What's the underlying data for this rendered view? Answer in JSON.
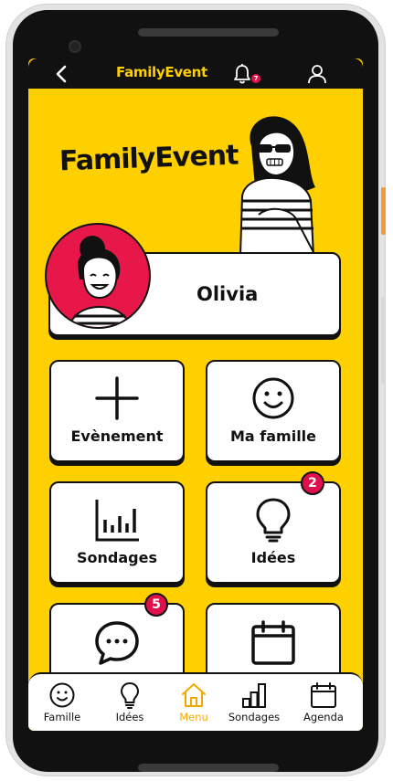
{
  "header": {
    "title": "FamilyEvent",
    "notification_count": "7"
  },
  "brand": {
    "name": "FamilyEvent"
  },
  "profile": {
    "name": "Olivia"
  },
  "tiles": [
    {
      "label": "Evènement",
      "icon": "plus-icon"
    },
    {
      "label": "Ma famille",
      "icon": "smiley-icon"
    },
    {
      "label": "Sondages",
      "icon": "bar-chart-icon"
    },
    {
      "label": "Idées",
      "icon": "lightbulb-icon",
      "badge": "2"
    },
    {
      "label": "",
      "icon": "chat-icon",
      "badge": "5"
    },
    {
      "label": "",
      "icon": "calendar-icon"
    }
  ],
  "bottom_nav": [
    {
      "label": "Famille",
      "icon": "smiley-icon"
    },
    {
      "label": "Idées",
      "icon": "lightbulb-icon"
    },
    {
      "label": "Menu",
      "icon": "home-icon",
      "active": true
    },
    {
      "label": "Sondages",
      "icon": "bar-chart-icon"
    },
    {
      "label": "Agenda",
      "icon": "calendar-icon"
    }
  ],
  "colors": {
    "primary": "#ffd000",
    "dark": "#111111",
    "badge": "#e0114a",
    "active_nav": "#f3a800"
  }
}
